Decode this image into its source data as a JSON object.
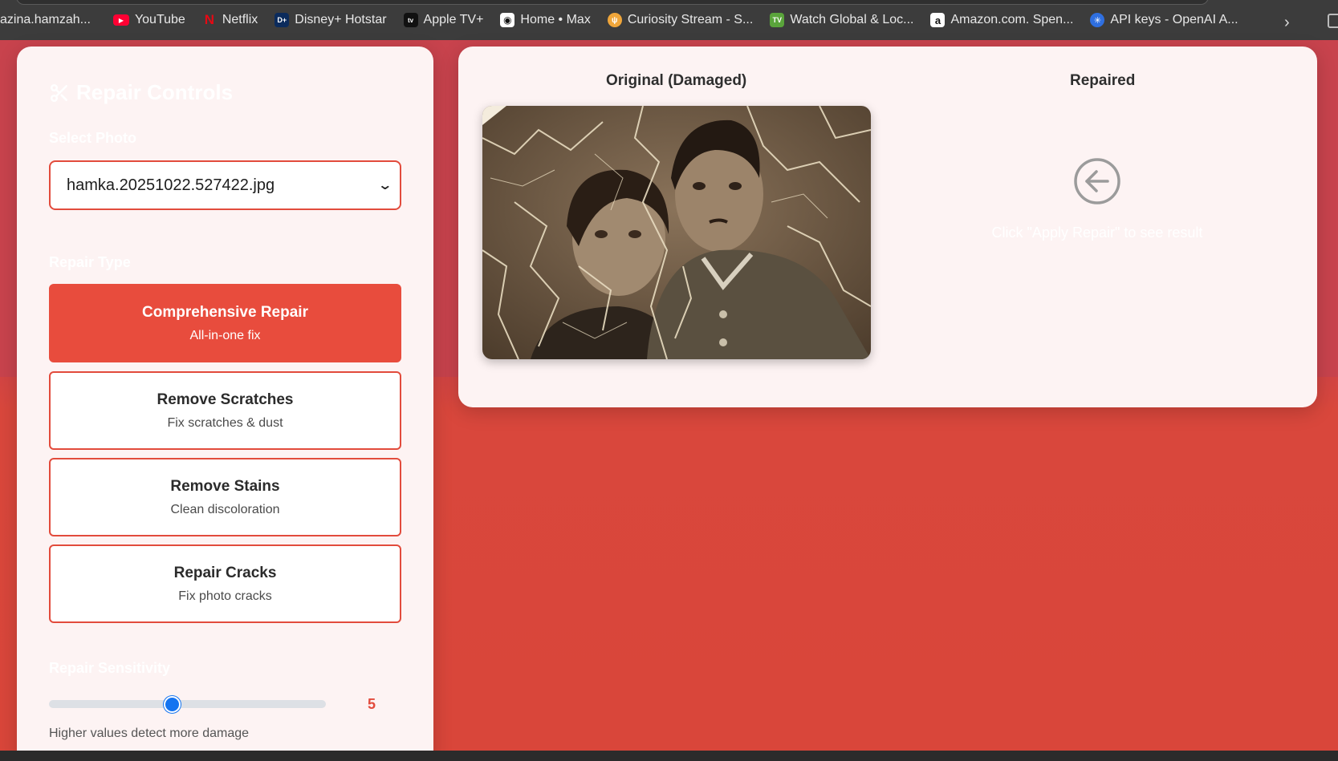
{
  "bookmarks": [
    {
      "label": "azina.hamzah...",
      "icon": "bookmark-icon",
      "color": "#3c3c3c"
    },
    {
      "label": "YouTube",
      "icon": "youtube-icon",
      "color": "#ff0000"
    },
    {
      "label": "Netflix",
      "icon": "netflix-icon",
      "color": "#e50914"
    },
    {
      "label": "Disney+ Hotstar",
      "icon": "disney-icon",
      "color": "#0b2b5c"
    },
    {
      "label": "Apple TV+",
      "icon": "appletv-icon",
      "color": "#111111"
    },
    {
      "label": "Home • Max",
      "icon": "max-icon",
      "color": "#111111"
    },
    {
      "label": "Curiosity Stream - S...",
      "icon": "curiosity-icon",
      "color": "#f0a63a"
    },
    {
      "label": "Watch Global & Loc...",
      "icon": "tv-icon",
      "color": "#5aa43b"
    },
    {
      "label": "Amazon.com. Spen...",
      "icon": "amazon-icon",
      "color": "#ffffff"
    },
    {
      "label": "API keys - OpenAI A...",
      "icon": "openai-icon",
      "color": "#2f6fe0"
    }
  ],
  "controls": {
    "title": "Repair Controls",
    "select_label": "Select Photo",
    "selected_photo": "hamka.20251022.527422.jpg",
    "repair_type_label": "Repair Type",
    "repair_types": [
      {
        "title": "Comprehensive Repair",
        "desc": "All-in-one fix",
        "active": true
      },
      {
        "title": "Remove Scratches",
        "desc": "Fix scratches & dust",
        "active": false
      },
      {
        "title": "Remove Stains",
        "desc": "Clean discoloration",
        "active": false
      },
      {
        "title": "Repair Cracks",
        "desc": "Fix photo cracks",
        "active": false
      }
    ],
    "sensitivity_label": "Repair Sensitivity",
    "sensitivity_value": "5",
    "sensitivity_hint": "Higher values detect more damage"
  },
  "preview": {
    "original_heading": "Original (Damaged)",
    "repaired_heading": "Repaired",
    "repaired_placeholder": "Click \"Apply Repair\" to see result"
  },
  "colors": {
    "accent": "#e84c3d",
    "slider": "#1574f0",
    "panel_bg": "#fdf3f3"
  }
}
